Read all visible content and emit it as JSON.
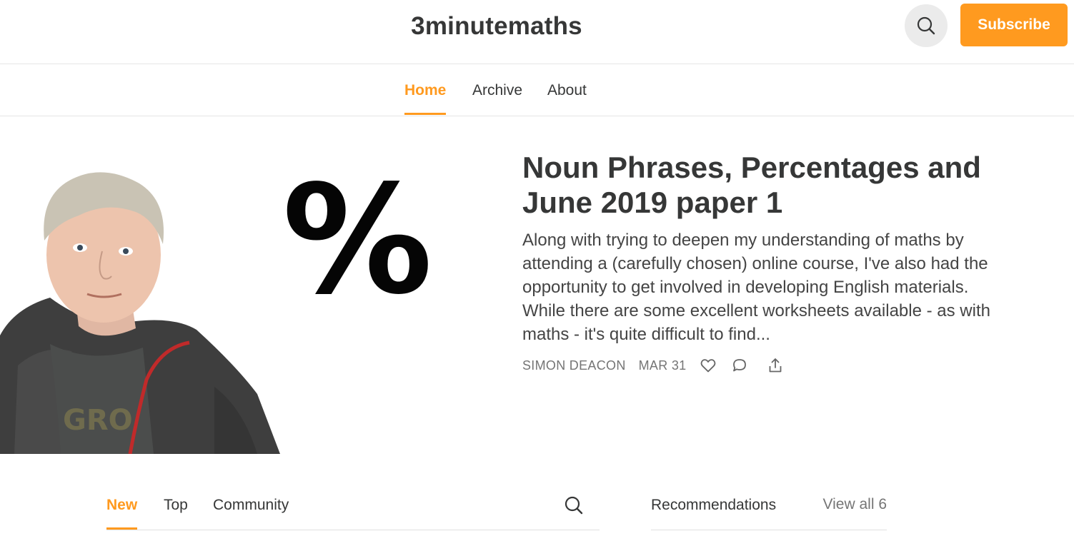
{
  "header": {
    "publication_title": "3minutemaths",
    "search_icon": "search-icon",
    "subscribe_label": "Subscribe",
    "accent_color": "#ff9a1f"
  },
  "nav": {
    "items": [
      {
        "label": "Home",
        "active": true
      },
      {
        "label": "Archive",
        "active": false
      },
      {
        "label": "About",
        "active": false
      }
    ]
  },
  "featured_post": {
    "image_overlay_text": "%",
    "title": "Noun Phrases, Percentages and June 2019 paper 1",
    "excerpt": "Along with trying to deepen my understanding of maths by attending a (carefully chosen) online course, I've also had the opportunity to get involved in developing English materials. While there are some excellent worksheets available - as with maths - it's quite difficult to find...",
    "author": "SIMON DEACON",
    "date": "MAR 31",
    "actions": [
      "heart-icon",
      "comment-icon",
      "share-icon"
    ]
  },
  "feed_tabs": {
    "items": [
      {
        "label": "New",
        "active": true
      },
      {
        "label": "Top",
        "active": false
      },
      {
        "label": "Community",
        "active": false
      }
    ],
    "search_icon": "search-icon"
  },
  "recommendations": {
    "title": "Recommendations",
    "view_all_label": "View all 6"
  }
}
